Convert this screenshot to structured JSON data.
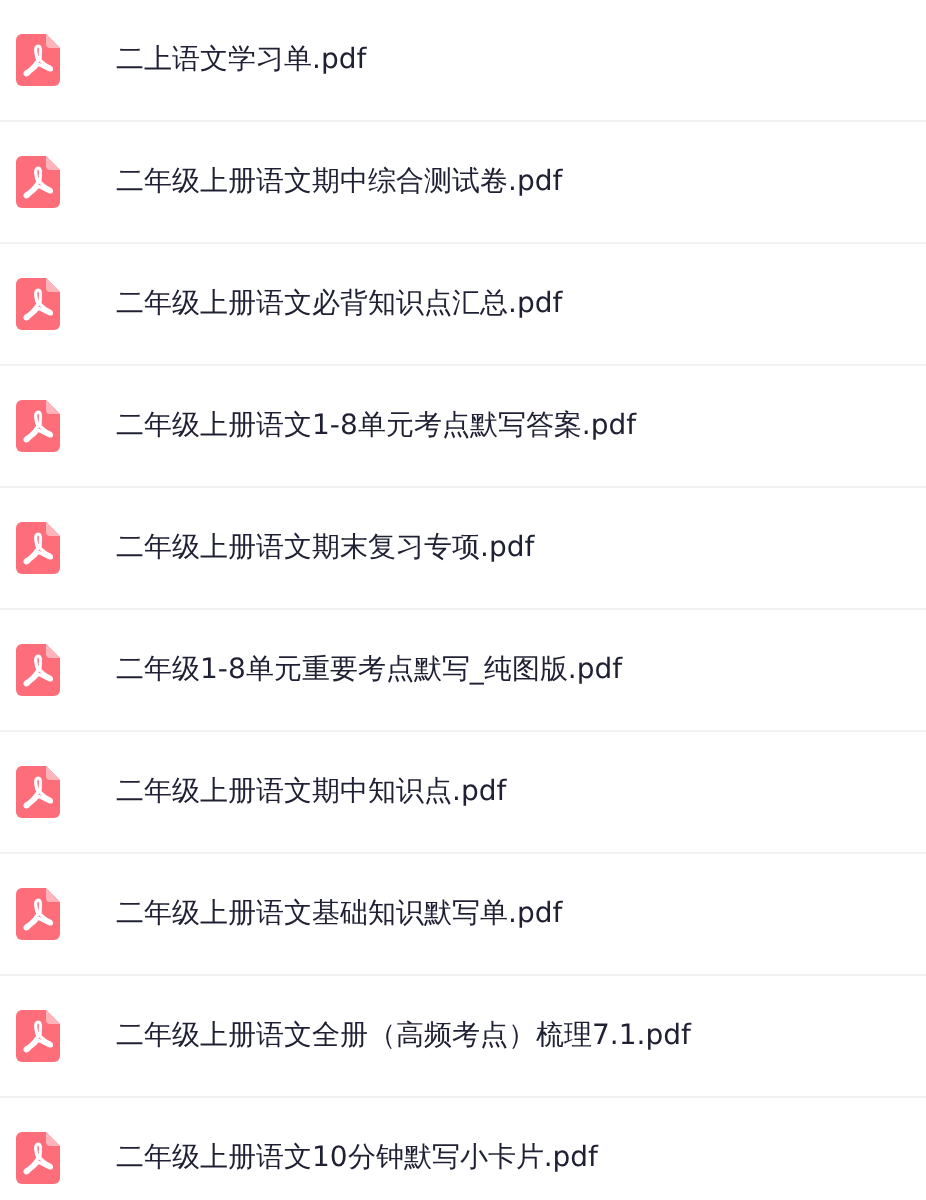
{
  "files": [
    {
      "name": "二上语文学习单.pdf"
    },
    {
      "name": "二年级上册语文期中综合测试卷.pdf"
    },
    {
      "name": "二年级上册语文必背知识点汇总.pdf"
    },
    {
      "name": "二年级上册语文1-8单元考点默写答案.pdf"
    },
    {
      "name": "二年级上册语文期末复习专项.pdf"
    },
    {
      "name": "二年级1-8单元重要考点默写_纯图版.pdf"
    },
    {
      "name": "二年级上册语文期中知识点.pdf"
    },
    {
      "name": "二年级上册语文基础知识默写单.pdf"
    },
    {
      "name": "二年级上册语文全册（高频考点）梳理7.1.pdf"
    },
    {
      "name": "二年级上册语文10分钟默写小卡片.pdf"
    }
  ]
}
